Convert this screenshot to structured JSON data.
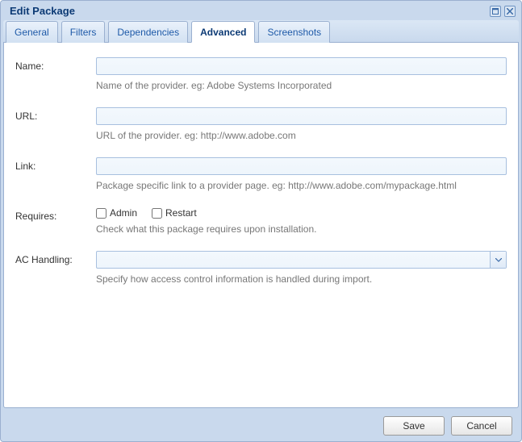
{
  "title": "Edit Package",
  "tabs": {
    "general": {
      "label": "General"
    },
    "filters": {
      "label": "Filters"
    },
    "deps": {
      "label": "Dependencies"
    },
    "advanced": {
      "label": "Advanced"
    },
    "shots": {
      "label": "Screenshots"
    }
  },
  "form": {
    "name": {
      "label": "Name:",
      "value": "",
      "hint": "Name of the provider. eg: Adobe Systems Incorporated"
    },
    "url": {
      "label": "URL:",
      "value": "",
      "hint": "URL of the provider. eg: http://www.adobe.com"
    },
    "link": {
      "label": "Link:",
      "value": "",
      "hint": "Package specific link to a provider page. eg: http://www.adobe.com/mypackage.html"
    },
    "requires": {
      "label": "Requires:",
      "admin_label": "Admin",
      "restart_label": "Restart",
      "admin_checked": false,
      "restart_checked": false,
      "hint": "Check what this package requires upon installation."
    },
    "achandling": {
      "label": "AC Handling:",
      "selected": "",
      "hint": "Specify how access control information is handled during import."
    }
  },
  "buttons": {
    "save": "Save",
    "cancel": "Cancel"
  }
}
